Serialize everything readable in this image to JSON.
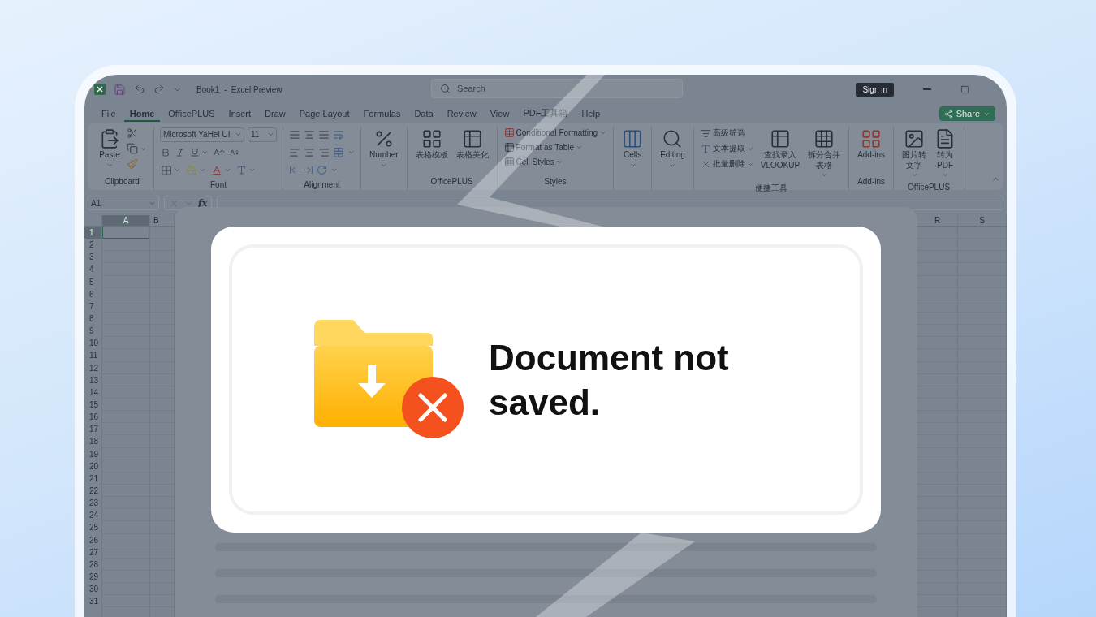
{
  "title_bar": {
    "document_title": "Book1  -  Excel Preview",
    "search": {
      "placeholder": "Search"
    },
    "sign_in": "Sign in"
  },
  "menu": {
    "tabs": [
      {
        "label": "File",
        "selected": false
      },
      {
        "label": "Home",
        "selected": true
      },
      {
        "label": "OfficePLUS",
        "selected": false
      },
      {
        "label": "Insert",
        "selected": false
      },
      {
        "label": "Draw",
        "selected": false
      },
      {
        "label": "Page Layout",
        "selected": false
      },
      {
        "label": "Formulas",
        "selected": false
      },
      {
        "label": "Data",
        "selected": false
      },
      {
        "label": "Review",
        "selected": false
      },
      {
        "label": "View",
        "selected": false
      },
      {
        "label": "PDF工具箱",
        "selected": false
      },
      {
        "label": "Help",
        "selected": false
      }
    ],
    "share": "Share"
  },
  "ribbon": {
    "groups": [
      {
        "kind": "clipboard",
        "label": "Clipboard",
        "paste": {
          "label": "Paste",
          "dropdown": true
        }
      },
      {
        "kind": "font",
        "label": "Font",
        "font_name": "Microsoft YaHei UI",
        "font_size": "11"
      },
      {
        "kind": "alignment",
        "label": "Alignment"
      },
      {
        "kind": "number",
        "buttons": [
          {
            "label": "Number",
            "dropdown": true
          }
        ]
      },
      {
        "kind": "templates",
        "label": "OfficePLUS",
        "buttons": [
          {
            "label": "表格模板",
            "dropdown": false
          },
          {
            "label": "表格美化",
            "dropdown": false
          }
        ]
      },
      {
        "kind": "styles",
        "label": "Styles",
        "entries": [
          {
            "label": "Conditional Formatting",
            "dropdown": true
          },
          {
            "label": "Format as Table",
            "dropdown": true
          },
          {
            "label": "Cell Styles",
            "dropdown": true
          }
        ]
      },
      {
        "kind": "cells",
        "buttons": [
          {
            "label": "Cells",
            "dropdown": true
          }
        ]
      },
      {
        "kind": "editing",
        "buttons": [
          {
            "label": "Editing",
            "dropdown": true
          }
        ]
      },
      {
        "kind": "tools",
        "label": "便捷工具",
        "entries": [
          {
            "label": "高级筛选",
            "dropdown": false
          },
          {
            "label": "文本提取",
            "dropdown": true
          },
          {
            "label": "批量删除",
            "dropdown": true
          }
        ],
        "buttons": [
          {
            "lines": [
              "查找录入",
              "VLOOKUP"
            ],
            "dropdown": false
          },
          {
            "lines": [
              "拆分合并",
              "表格"
            ],
            "dropdown": true
          }
        ]
      },
      {
        "kind": "addins",
        "label": "Add-ins",
        "buttons": [
          {
            "label": "Add-ins",
            "dropdown": false
          }
        ]
      },
      {
        "kind": "convert",
        "label": "OfficePLUS",
        "buttons": [
          {
            "lines": [
              "图片转",
              "文字"
            ],
            "dropdown": true
          },
          {
            "lines": [
              "转为",
              "PDF"
            ],
            "dropdown": true
          }
        ]
      }
    ]
  },
  "formula_bar": {
    "name_box": "A1",
    "function_label": "fx"
  },
  "sheet": {
    "columns_left": [
      {
        "label": "A",
        "selected": true
      },
      {
        "label": "B",
        "selected": false
      }
    ],
    "columns_right": [
      {
        "label": "R",
        "selected": false
      },
      {
        "label": "S",
        "selected": false
      }
    ],
    "rows": [
      {
        "label": "1",
        "selected": true
      },
      {
        "label": "2",
        "selected": false
      },
      {
        "label": "3",
        "selected": false
      },
      {
        "label": "4",
        "selected": false
      },
      {
        "label": "5",
        "selected": false
      },
      {
        "label": "6",
        "selected": false
      },
      {
        "label": "7",
        "selected": false
      },
      {
        "label": "8",
        "selected": false
      },
      {
        "label": "9",
        "selected": false
      },
      {
        "label": "10",
        "selected": false
      },
      {
        "label": "11",
        "selected": false
      },
      {
        "label": "12",
        "selected": false
      },
      {
        "label": "13",
        "selected": false
      },
      {
        "label": "14",
        "selected": false
      },
      {
        "label": "15",
        "selected": false
      },
      {
        "label": "16",
        "selected": false
      },
      {
        "label": "17",
        "selected": false
      },
      {
        "label": "18",
        "selected": false
      },
      {
        "label": "19",
        "selected": false
      },
      {
        "label": "20",
        "selected": false
      },
      {
        "label": "21",
        "selected": false
      },
      {
        "label": "22",
        "selected": false
      },
      {
        "label": "23",
        "selected": false
      },
      {
        "label": "24",
        "selected": false
      },
      {
        "label": "25",
        "selected": false
      },
      {
        "label": "26",
        "selected": false
      },
      {
        "label": "27",
        "selected": false
      },
      {
        "label": "28",
        "selected": false
      },
      {
        "label": "29",
        "selected": false
      },
      {
        "label": "30",
        "selected": false
      },
      {
        "label": "31",
        "selected": false
      }
    ]
  },
  "dialog": {
    "message": "Document not saved."
  }
}
